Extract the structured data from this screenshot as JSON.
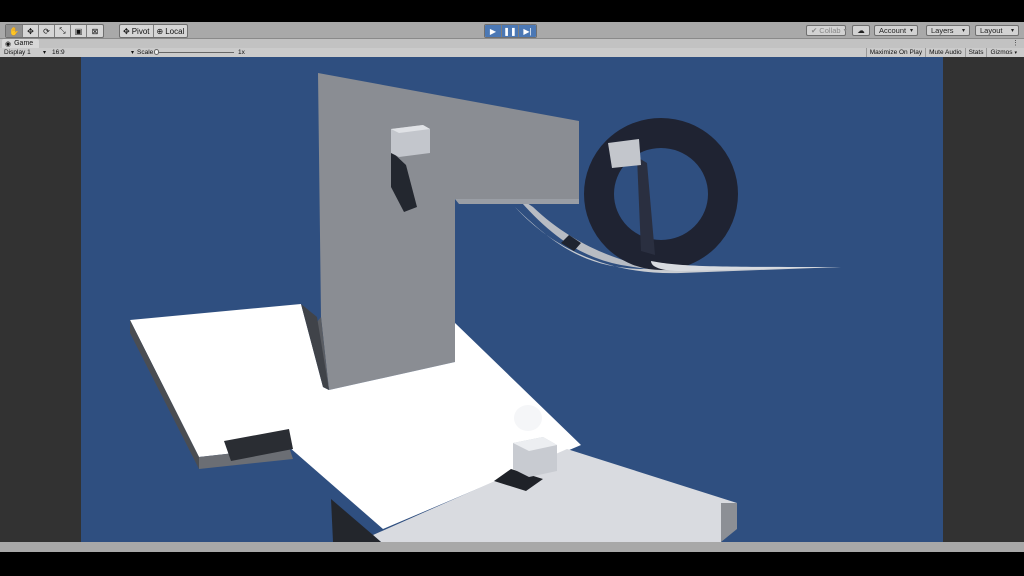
{
  "toolbar": {
    "tools": [
      {
        "name": "hand-tool",
        "glyph": "✋"
      },
      {
        "name": "move-tool",
        "glyph": "✥"
      },
      {
        "name": "rotate-tool",
        "glyph": "⟳"
      },
      {
        "name": "scale-tool",
        "glyph": "⤡"
      },
      {
        "name": "rect-tool",
        "glyph": "▣"
      },
      {
        "name": "transform-tool",
        "glyph": "⊠"
      }
    ],
    "pivot_label": "Pivot",
    "local_label": "Local",
    "play_glyph": "▶",
    "pause_glyph": "❚❚",
    "step_glyph": "▶|",
    "collab_label": "Collab",
    "account_label": "Account",
    "layers_label": "Layers",
    "layout_label": "Layout"
  },
  "game_tab": {
    "title": "Game"
  },
  "game_bar": {
    "display": "Display 1",
    "aspect": "16:9",
    "scale_label": "Scale",
    "scale_value": "1x",
    "maximize": "Maximize On Play",
    "mute": "Mute Audio",
    "stats": "Stats",
    "gizmos": "Gizmos"
  },
  "colors": {
    "sky": "#2f4f80",
    "accent_play": "#4b78b5"
  }
}
